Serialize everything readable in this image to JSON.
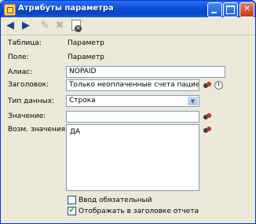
{
  "window": {
    "title": "Атрибуты параметра"
  },
  "toolbar": {
    "back_icon": "arrow-left-icon",
    "forward_icon": "arrow-right-icon",
    "edit_icon": "pencil-icon",
    "delete_icon": "delete-icon",
    "remove_icon": "document-remove-icon"
  },
  "fields": {
    "table_label": "Таблица:",
    "table_value": "Параметр",
    "field_label": "Поле:",
    "field_value": "Параметр",
    "alias_label": "Алиас:",
    "alias_value": "NOPAID",
    "caption_label": "Заголовок:",
    "caption_value": "Только неоплаченные счета пациентов",
    "datatype_label": "Тип данных:",
    "datatype_value": "Строка",
    "value_label": "Значение:",
    "value_value": "",
    "possible_label": "Возм. значения:",
    "possible_values": "ДА"
  },
  "checkboxes": [
    {
      "label": "Ввод обязательный",
      "checked": false
    },
    {
      "label": "Отображать в заголовке отчета",
      "checked": true
    }
  ],
  "colors": {
    "titlebar": "#0a4fd6",
    "background": "#ece9d8",
    "input_border": "#7f9db9"
  }
}
